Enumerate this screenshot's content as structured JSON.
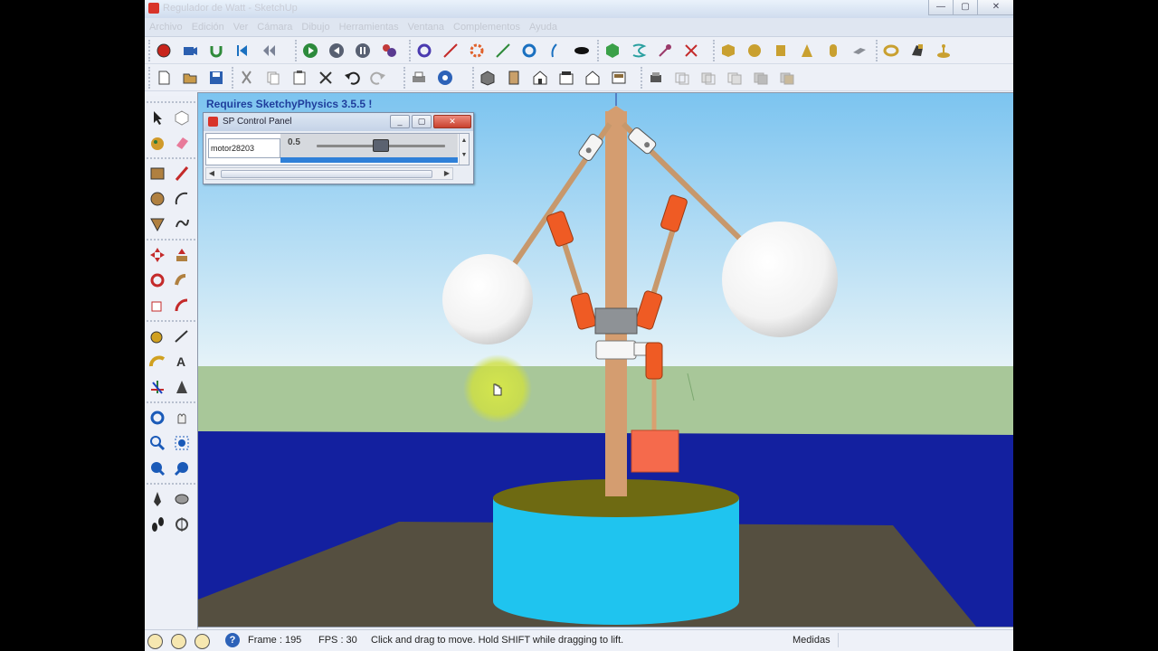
{
  "window": {
    "title": "Regulador de Watt - SketchUp",
    "controls": {
      "minimize": "—",
      "maximize": "▢",
      "close": "✕"
    }
  },
  "menu": [
    "Archivo",
    "Edición",
    "Ver",
    "Cámara",
    "Dibujo",
    "Herramientas",
    "Ventana",
    "Complementos",
    "Ayuda"
  ],
  "viewport": {
    "label": "Requires SketchyPhysics 3.5.5 !",
    "colors": {
      "sky_top": "#7cc4f0",
      "sky_bottom": "#e6f3f8",
      "grass": "#a8c799",
      "water": "#13209f",
      "ground": "#554f40",
      "cylinder": "#1fc4ef",
      "cylinder_top": "#6e6a12",
      "pole": "#d49d70",
      "arm": "#c7986c",
      "joint": "#ef5b24",
      "weight": "#f56a4c",
      "cursor_glow": "#d7e84a"
    }
  },
  "sp_panel": {
    "title": "SP Control Panel",
    "motor_name": "motor28203",
    "value": "0.5",
    "slider_level": 0.5
  },
  "status": {
    "frame": "Frame : 195",
    "fps": "FPS : 30",
    "hint": "Click and drag to move. Hold SHIFT while dragging to lift.",
    "measure_label": "Medidas",
    "help": "?"
  }
}
